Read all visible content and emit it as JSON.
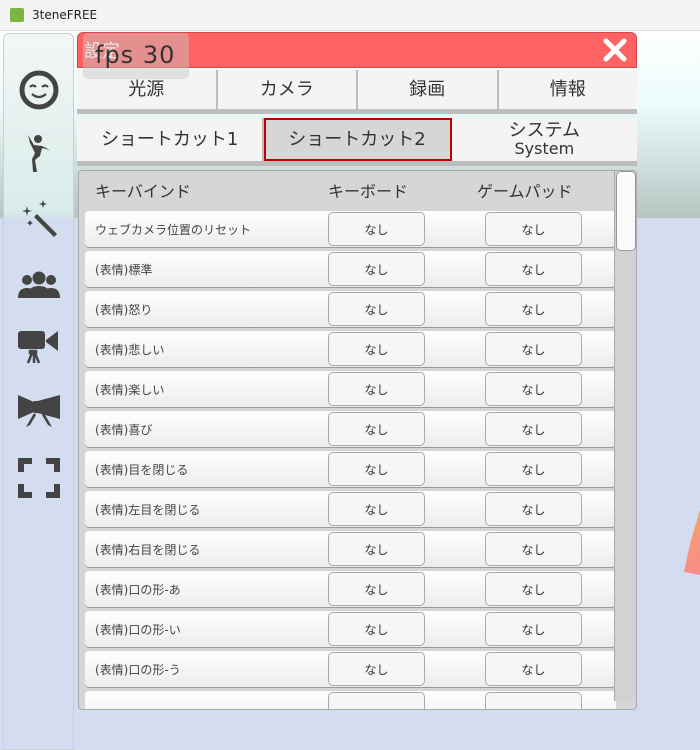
{
  "window": {
    "title": "3teneFREE"
  },
  "overlay": {
    "fps": "fps  30"
  },
  "dialog": {
    "title": "設定"
  },
  "tabs_row1": [
    {
      "label": "光源"
    },
    {
      "label": "カメラ"
    },
    {
      "label": "録画"
    },
    {
      "label": "情報"
    }
  ],
  "tabs_row2": [
    {
      "label": "ショートカット1"
    },
    {
      "label": "ショートカット2",
      "selected": true
    },
    {
      "label": "システム",
      "sub": "System"
    }
  ],
  "table": {
    "headers": {
      "binding": "キーバインド",
      "keyboard": "キーボード",
      "gamepad": "ゲームパッド"
    },
    "rows": [
      {
        "label": "ウェブカメラ位置のリセット",
        "keyboard": "なし",
        "gamepad": "なし"
      },
      {
        "label": "(表情)標準",
        "keyboard": "なし",
        "gamepad": "なし"
      },
      {
        "label": "(表情)怒り",
        "keyboard": "なし",
        "gamepad": "なし"
      },
      {
        "label": "(表情)悲しい",
        "keyboard": "なし",
        "gamepad": "なし"
      },
      {
        "label": "(表情)楽しい",
        "keyboard": "なし",
        "gamepad": "なし"
      },
      {
        "label": "(表情)喜び",
        "keyboard": "なし",
        "gamepad": "なし"
      },
      {
        "label": "(表情)目を閉じる",
        "keyboard": "なし",
        "gamepad": "なし"
      },
      {
        "label": "(表情)左目を閉じる",
        "keyboard": "なし",
        "gamepad": "なし"
      },
      {
        "label": "(表情)右目を閉じる",
        "keyboard": "なし",
        "gamepad": "なし"
      },
      {
        "label": "(表情)口の形-あ",
        "keyboard": "なし",
        "gamepad": "なし"
      },
      {
        "label": "(表情)口の形-い",
        "keyboard": "なし",
        "gamepad": "なし"
      },
      {
        "label": "(表情)口の形-う",
        "keyboard": "なし",
        "gamepad": "なし"
      },
      {
        "label": "",
        "keyboard": "",
        "gamepad": ""
      }
    ]
  },
  "sidebar": {
    "icons": [
      "face-icon",
      "pose-icon",
      "magic-wand-icon",
      "people-icon",
      "video-camera-icon",
      "bow-icon",
      "fullscreen-icon"
    ]
  },
  "colors": {
    "header": "#ff6262",
    "selected_outline": "#c00000",
    "background": "#d3ddef"
  }
}
